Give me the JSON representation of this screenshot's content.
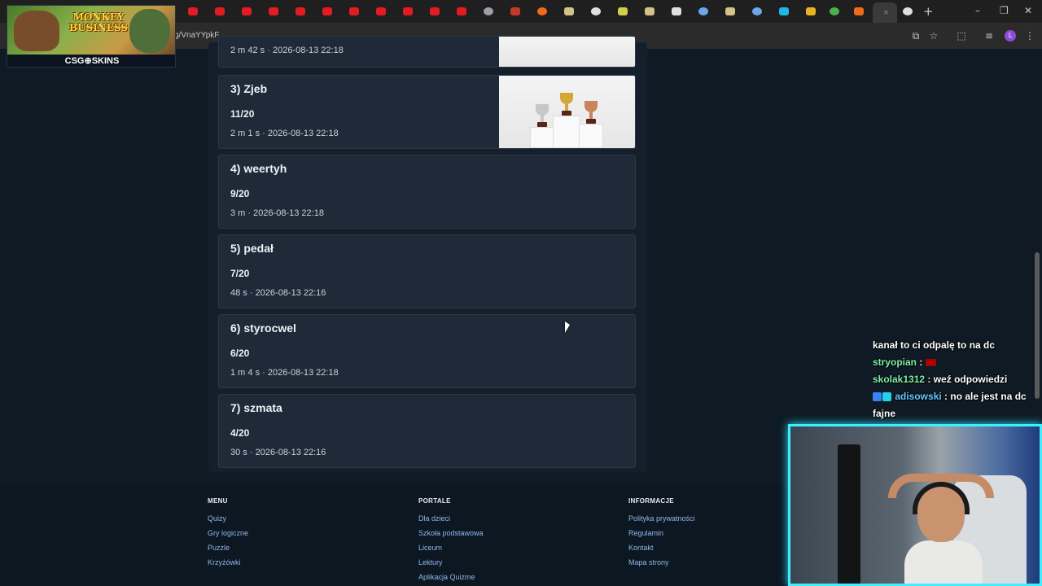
{
  "browser": {
    "url": "g/VnaYYpkF",
    "tab_close": "×",
    "new_tab": "+",
    "window_controls": [
      "–",
      "❐",
      "✕"
    ],
    "profile_initial": "L"
  },
  "ad": {
    "title": "MONKEY BUSINESS",
    "brand": "CSG⊕SKINS"
  },
  "top_card": {
    "meta": "2 m 42 s · 2026-08-13 22:18"
  },
  "results": [
    {
      "name": "3) Zjeb",
      "score": "11/20",
      "meta": "2 m 1 s · 2026-08-13 22:18",
      "has_trophy_image": true
    },
    {
      "name": "4) weertyh",
      "score": "9/20",
      "meta": "3 m · 2026-08-13 22:18"
    },
    {
      "name": "5) pedał",
      "score": "7/20",
      "meta": "48 s · 2026-08-13 22:16"
    },
    {
      "name": "6) styrocwel",
      "score": "6/20",
      "meta": "1 m 4 s · 2026-08-13 22:18"
    },
    {
      "name": "7) szmata",
      "score": "4/20",
      "meta": "30 s · 2026-08-13 22:16"
    }
  ],
  "footer": {
    "menu": {
      "heading": "MENU",
      "links": [
        "Quizy",
        "Gry logiczne",
        "Puzzle",
        "Krzyżówki"
      ]
    },
    "portale": {
      "heading": "PORTALE",
      "links": [
        "Dla dzieci",
        "Szkoła podstawowa",
        "Liceum",
        "Lektury",
        "Aplikacja Quizme"
      ]
    },
    "informacje": {
      "heading": "INFORMACJE",
      "links": [
        "Polityka prywatności",
        "Regulamin",
        "Kontakt",
        "Mapa strony"
      ]
    }
  },
  "chat": [
    {
      "user": "",
      "message": "kanał to ci odpalę to na dc"
    },
    {
      "user": "stryopian",
      "message": " : "
    },
    {
      "user": "skolak1312",
      "message": " : weź odpowiedzi"
    },
    {
      "user": "adisowski",
      "message": " : no ale jest na dc fajne"
    }
  ],
  "colors": {
    "page_bg": "#0f1a24",
    "card_bg": "#1e2a38",
    "link": "#8fb8e6",
    "chat_user_green": "#7ef0a8",
    "chat_user_blue": "#67c8ff",
    "cam_border": "#3ef0ff"
  }
}
